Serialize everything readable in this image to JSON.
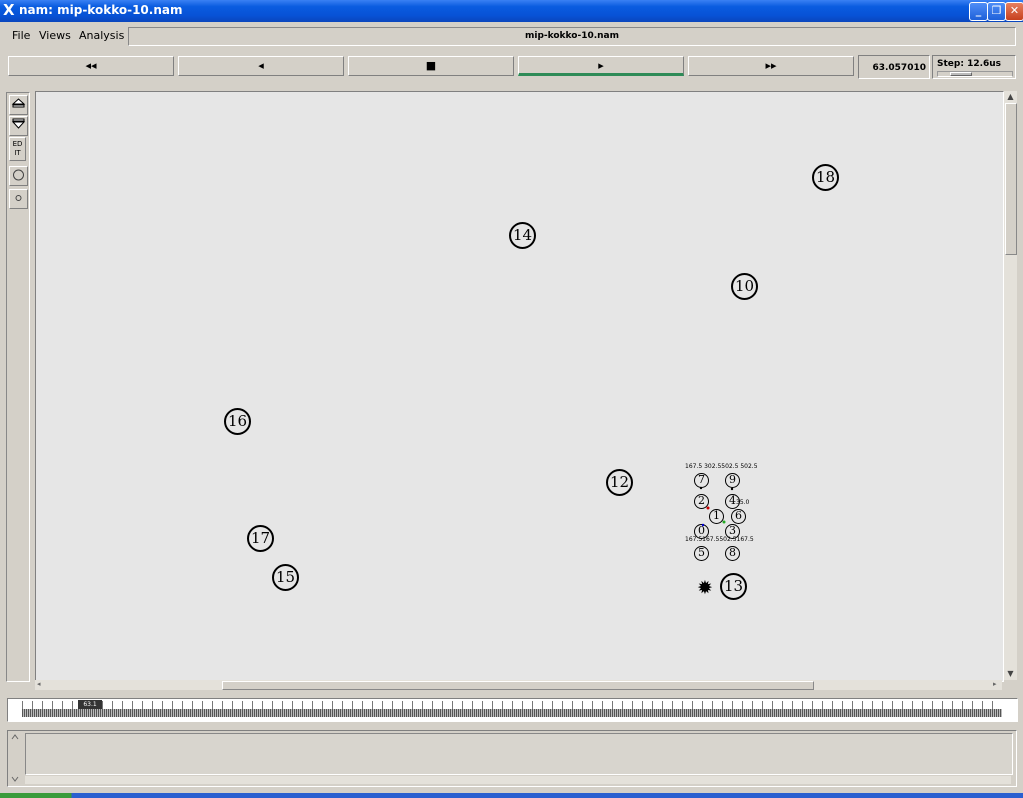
{
  "window": {
    "title": "nam: mip-kokko-10.nam"
  },
  "menu": {
    "file": "File",
    "views": "Views",
    "analysis": "Analysis",
    "filename": "mip-kokko-10.nam"
  },
  "controls": {
    "rewind": "◂◂",
    "back": "◂",
    "stop": "■",
    "play": "▸",
    "fast_forward": "▸▸",
    "time": "63.057010",
    "step": "Step: 12.6us"
  },
  "left_tools": {
    "edit": "ED IT"
  },
  "nodes": {
    "n18": "18",
    "n14": "14",
    "n10": "10",
    "n16": "16",
    "n12": "12",
    "n17": "17",
    "n15": "15",
    "n13": "13",
    "n7": "7",
    "n9": "9",
    "n2": "2",
    "n4": "4",
    "n1": "1",
    "n6": "6",
    "n0": "0",
    "n3": "3",
    "n5": "5",
    "n8": "8"
  },
  "cluster_labels": {
    "top": "167.5 302.5502.5 502.5",
    "mid": "35.0",
    "bottom": "167.5167.5502.5167.5"
  },
  "timeline": {
    "marker": "63.1"
  }
}
